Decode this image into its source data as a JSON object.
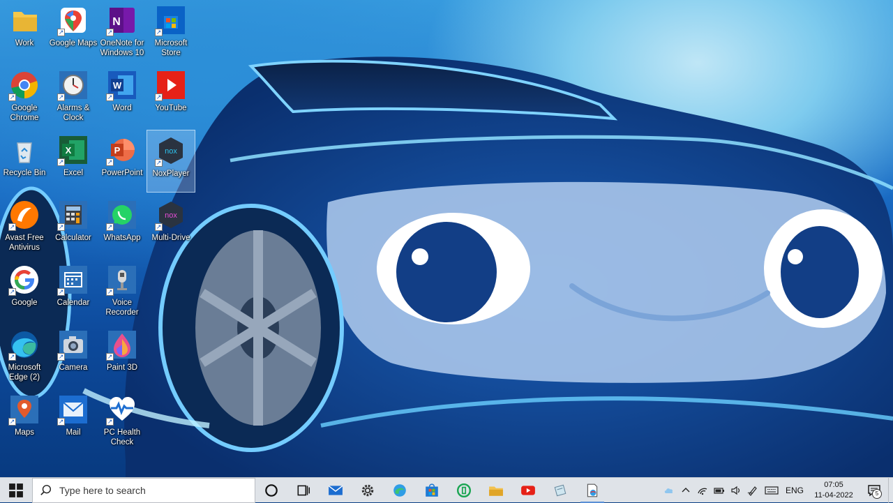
{
  "desktop": {
    "icons": [
      {
        "label": "Work"
      },
      {
        "label": "Google Maps"
      },
      {
        "label": "OneNote for Windows 10"
      },
      {
        "label": "Microsoft Store"
      },
      {
        "label": "Google Chrome"
      },
      {
        "label": "Alarms & Clock"
      },
      {
        "label": "Word"
      },
      {
        "label": "YouTube"
      },
      {
        "label": "Recycle Bin"
      },
      {
        "label": "Excel"
      },
      {
        "label": "PowerPoint"
      },
      {
        "label": "NoxPlayer"
      },
      {
        "label": "Avast Free Antivirus"
      },
      {
        "label": "Calculator"
      },
      {
        "label": "WhatsApp"
      },
      {
        "label": "Multi-Drive"
      },
      {
        "label": "Google"
      },
      {
        "label": "Calendar"
      },
      {
        "label": "Voice Recorder"
      },
      {
        "label": "Microsoft Edge (2)"
      },
      {
        "label": "Camera"
      },
      {
        "label": "Paint 3D"
      },
      {
        "label": "Maps"
      },
      {
        "label": "Mail"
      },
      {
        "label": "PC Health Check"
      }
    ],
    "selected_icon": "NoxPlayer"
  },
  "taskbar": {
    "search_placeholder": "Type here to search",
    "pinned": [
      "cortana",
      "task-view",
      "mail",
      "settings",
      "edge",
      "store",
      "app-green",
      "file-explorer",
      "youtube",
      "notes",
      "browser-active"
    ],
    "tray": {
      "language": "ENG",
      "time": "07:05",
      "date": "11-04-2022",
      "notification_count": "5"
    }
  },
  "colors": {
    "taskbar_bg": "#dfe3e8",
    "accent": "#0078d7"
  }
}
